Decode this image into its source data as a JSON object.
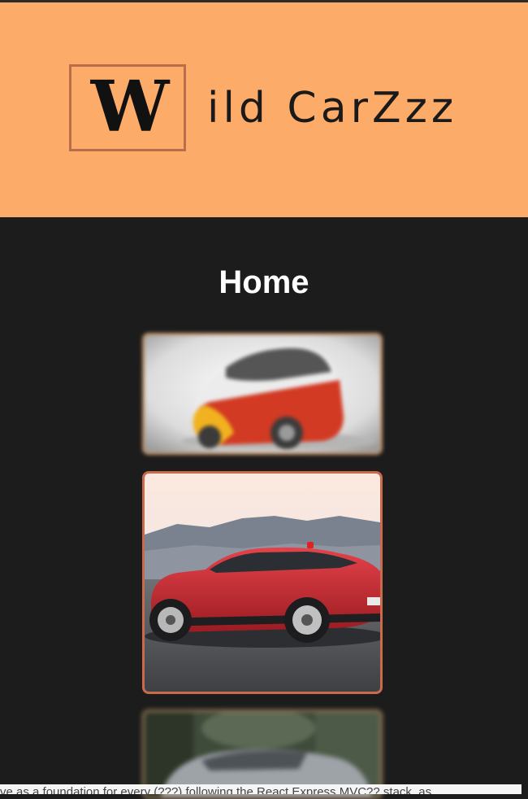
{
  "header": {
    "logo_letter": "W",
    "logo_rest": "ild CarZzz",
    "background_color": "#fdab68",
    "logo_frame_color": "#b86e4c"
  },
  "main": {
    "title": "Home",
    "cards": [
      {
        "subject": "red and white concept city car",
        "blurred": true,
        "border_color": "#c19066"
      },
      {
        "subject": "red electric crossover in front of mountains",
        "blurred": false,
        "border_color": "#c96a4a"
      },
      {
        "subject": "grey car under trees",
        "blurred": true,
        "border_color": "#9b7b57"
      }
    ]
  },
  "footer": {
    "text": "ve as a foundation for every (???) following the React Express MVC?? stack, as"
  }
}
